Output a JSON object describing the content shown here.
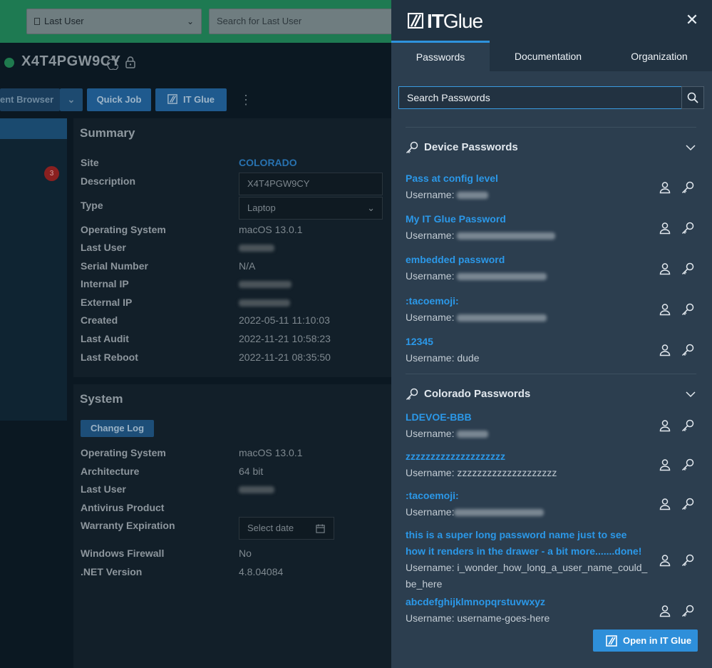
{
  "app": {
    "filter_select": "Last User",
    "search_placeholder": "Search for Last User",
    "device_name": "X4T4PGW9CY",
    "buttons": {
      "remote_browser": "ent Browser",
      "quick_job": "Quick Job",
      "it_glue": "IT Glue"
    },
    "nav_badge": "3",
    "summary": {
      "title": "Summary",
      "rows": [
        {
          "label": "Site",
          "value": "COLORADO"
        },
        {
          "label": "Description",
          "value": "X4T4PGW9CY"
        },
        {
          "label": "Type",
          "value": "Laptop"
        },
        {
          "label": "Operating System",
          "value": "macOS 13.0.1"
        },
        {
          "label": "Last User",
          "value": ""
        },
        {
          "label": "Serial Number",
          "value": "N/A"
        },
        {
          "label": "Internal IP",
          "value": ""
        },
        {
          "label": "External IP",
          "value": ""
        },
        {
          "label": "Created",
          "value": "2022-05-11 11:10:03"
        },
        {
          "label": "Last Audit",
          "value": "2022-11-21 10:58:23"
        },
        {
          "label": "Last Reboot",
          "value": "2022-11-21 08:35:50"
        }
      ]
    },
    "system": {
      "title": "System",
      "change_log": "Change Log",
      "rows": [
        {
          "label": "Operating System",
          "value": "macOS 13.0.1"
        },
        {
          "label": "Architecture",
          "value": "64 bit"
        },
        {
          "label": "Last User",
          "value": ""
        },
        {
          "label": "Antivirus Product",
          "value": ""
        },
        {
          "label": "Warranty Expiration",
          "value": "Select date"
        },
        {
          "label": "Windows Firewall",
          "value": "No"
        },
        {
          "label": ".NET Version",
          "value": "4.8.04084"
        }
      ]
    }
  },
  "drawer": {
    "logo": {
      "it": "IT",
      "glue": "Glue"
    },
    "tabs": [
      "Passwords",
      "Documentation",
      "Organization"
    ],
    "search_placeholder": "Search Passwords",
    "username_prefix": "Username:",
    "sections": [
      {
        "title": "Device Passwords",
        "items": [
          {
            "name": "Pass at config level",
            "username": ""
          },
          {
            "name": "My IT Glue Password",
            "username": ""
          },
          {
            "name": "embedded password",
            "username": ""
          },
          {
            "name": ":tacoemoji:",
            "username": ""
          },
          {
            "name": "12345",
            "username": "dude"
          }
        ]
      },
      {
        "title": "Colorado Passwords",
        "items": [
          {
            "name": "LDEVOE-BBB",
            "username": ""
          },
          {
            "name": "zzzzzzzzzzzzzzzzzzzz",
            "username": "zzzzzzzzzzzzzzzzzzzz"
          },
          {
            "name": ":tacoemoji:",
            "username": ""
          },
          {
            "name": "this is a super long password name just to see how it renders in the drawer - a bit more.......done!",
            "username": "i_wonder_how_long_a_user_name_could_be_here"
          },
          {
            "name": "abcdefghijklmnopqrstuvwxyz",
            "username": "username-goes-here"
          }
        ]
      }
    ],
    "open_button": "Open in IT Glue"
  }
}
